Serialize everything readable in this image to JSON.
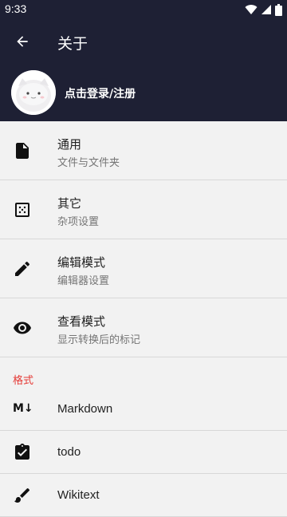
{
  "status_bar": {
    "time": "9:33",
    "icons": [
      "wifi-icon",
      "signal-icon",
      "battery-icon"
    ]
  },
  "toolbar": {
    "title": "关于",
    "back_icon": "arrow-left-icon"
  },
  "profile": {
    "login_label": "点击登录/注册",
    "avatar_icon": "cat-avatar-icon"
  },
  "settings": [
    {
      "title": "通用",
      "subtitle": "文件与文件夹",
      "icon": "file-icon"
    },
    {
      "title": "其它",
      "subtitle": "杂项设置",
      "icon": "dotted-square-icon"
    },
    {
      "title": "编辑模式",
      "subtitle": "编辑器设置",
      "icon": "pencil-icon"
    },
    {
      "title": "查看模式",
      "subtitle": "显示转换后的标记",
      "icon": "eye-icon"
    }
  ],
  "format_section": {
    "title": "格式",
    "items": [
      {
        "title": "Markdown",
        "icon": "markdown-icon",
        "icon_text": "M↓"
      },
      {
        "title": "todo",
        "icon": "clipboard-check-icon"
      },
      {
        "title": "Wikitext",
        "icon": "brush-icon"
      }
    ]
  },
  "colors": {
    "header_bg": "#1e2034",
    "section_accent": "#e53935",
    "background": "#f2f2f2"
  }
}
